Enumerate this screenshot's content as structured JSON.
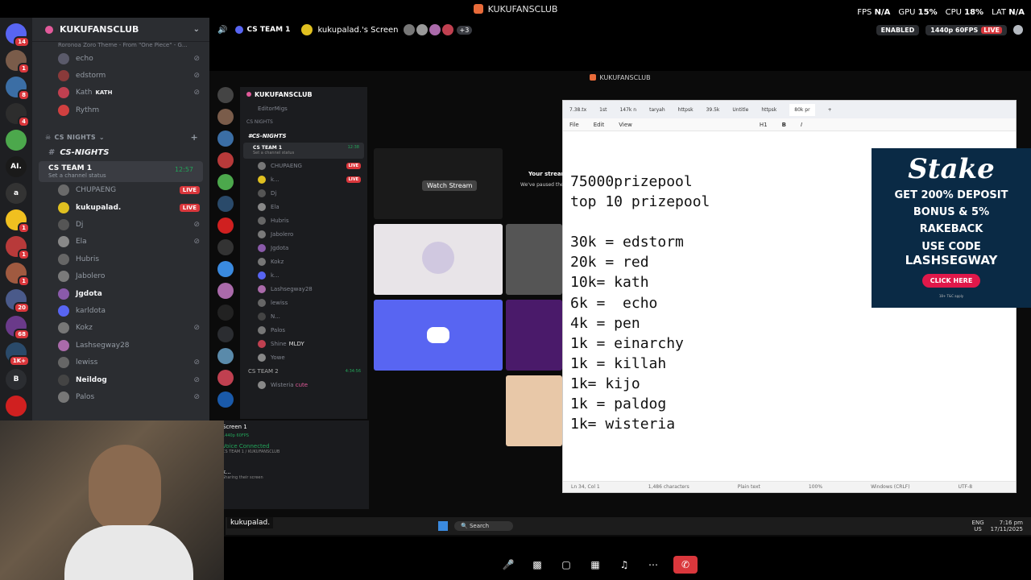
{
  "window": {
    "title": "KUKUFANSCLUB"
  },
  "guild_rail": {
    "items": [
      {
        "name": "discord-home-icon",
        "badge": "14",
        "color": "#5865f2"
      },
      {
        "name": "guild-icon",
        "badge": "1",
        "color": "#7a5c4a"
      },
      {
        "name": "guild-icon",
        "badge": "8",
        "color": "#3b6ea5"
      },
      {
        "name": "guild-icon",
        "badge": "4",
        "color": "#2d2d2d"
      },
      {
        "name": "guild-icon",
        "badge": "",
        "color": "#4ca84c"
      },
      {
        "name": "guild-icon",
        "badge": "",
        "label": "AI.",
        "color": "#1a1a1a"
      },
      {
        "name": "guild-icon",
        "badge": "",
        "label": "a",
        "color": "#333"
      },
      {
        "name": "guild-icon",
        "badge": "1",
        "color": "#f0c020"
      },
      {
        "name": "guild-icon",
        "badge": "1",
        "color": "#b83a3a"
      },
      {
        "name": "guild-icon",
        "badge": "1",
        "color": "#a05a40"
      },
      {
        "name": "guild-icon",
        "badge": "20",
        "color": "#4a5a8a"
      },
      {
        "name": "guild-icon",
        "badge": "68",
        "color": "#6a3a8a"
      },
      {
        "name": "guild-icon",
        "badge": "1K+",
        "color": "#2a4a6a"
      },
      {
        "name": "guild-icon",
        "badge": "",
        "label": "B",
        "color": "#2b2d31"
      },
      {
        "name": "guild-icon",
        "badge": "",
        "color": "#d02020"
      }
    ]
  },
  "channel_list": {
    "server_name": "KUKUFANSCLUB",
    "top_item": "Roronoa Zoro Theme - From \"One Piece\" - G...",
    "members_top": [
      {
        "name": "echo",
        "muted": true,
        "color": "#5a5a6a"
      },
      {
        "name": "edstorm",
        "muted": true,
        "color": "#8a3a3a"
      },
      {
        "name": "Kath",
        "tag": "KATH",
        "muted": true,
        "color": "#c04050"
      },
      {
        "name": "Rythm",
        "muted": false,
        "color": "#d04040"
      }
    ],
    "category": "CS NIGHTS",
    "text_channel": "CS-NIGHTS",
    "voice_channel": {
      "name": "CS TEAM 1",
      "status": "Set a channel status",
      "time": "12:57"
    },
    "members": [
      {
        "name": "CHUPAENG",
        "live": true,
        "muted": false,
        "color": "#6a6a6a"
      },
      {
        "name": "kukupalad.",
        "live": true,
        "muted": false,
        "color": "#e0c020",
        "bold": true
      },
      {
        "name": "Dj",
        "live": false,
        "muted": true,
        "color": "#555"
      },
      {
        "name": "Ela",
        "live": false,
        "muted": true,
        "color": "#888"
      },
      {
        "name": "Hubris",
        "live": false,
        "muted": false,
        "color": "#666"
      },
      {
        "name": "Jabolero",
        "live": false,
        "muted": false,
        "color": "#7a7a7a"
      },
      {
        "name": "Jgdota",
        "live": false,
        "muted": false,
        "color": "#8a5aaa",
        "bold": true
      },
      {
        "name": "karldota",
        "live": false,
        "muted": false,
        "color": "#5865f2"
      },
      {
        "name": "Kokz",
        "live": false,
        "muted": true,
        "color": "#777"
      },
      {
        "name": "Lashsegway28",
        "live": false,
        "muted": false,
        "color": "#aa6aaa"
      },
      {
        "name": "lewiss",
        "live": false,
        "muted": true,
        "color": "#666"
      },
      {
        "name": "Neildog",
        "live": false,
        "muted": true,
        "color": "#444",
        "bold": true
      },
      {
        "name": "Palos",
        "live": false,
        "muted": true,
        "color": "#777"
      }
    ],
    "live_label": "LIVE"
  },
  "topbar": {
    "channel": "CS TEAM 1",
    "screen_owner": "kukupalad.'s Screen",
    "extra_viewers": "+3"
  },
  "stats": {
    "fps_label": "FPS",
    "fps": "N/A",
    "gpu_label": "GPU",
    "gpu": "15%",
    "cpu_label": "CPU",
    "cpu": "18%",
    "lat_label": "LAT",
    "lat": "N/A",
    "enabled": "ENABLED",
    "quality": "1440p 60FPS",
    "live": "LIVE"
  },
  "shared_screen": {
    "title": "KUKUFANSCLUB",
    "inner_server": "KUKUFANSCLUB",
    "inner_first": "EditorMigs",
    "inner_category": "CS NIGHTS",
    "inner_text_channel": "CS-NIGHTS",
    "inner_voice": {
      "name": "CS TEAM 1",
      "status": "Set a channel status",
      "time": "12:38"
    },
    "inner_members": [
      {
        "name": "CHUPAENG",
        "live": true
      },
      {
        "name": "k...",
        "live": true
      },
      {
        "name": "Dj",
        "live": false
      },
      {
        "name": "Ela",
        "live": false
      },
      {
        "name": "Hubris",
        "live": false
      },
      {
        "name": "Jabolero",
        "live": false
      },
      {
        "name": "Jgdota",
        "live": false
      },
      {
        "name": "Kokz",
        "live": false
      },
      {
        "name": "k...",
        "live": false
      },
      {
        "name": "Lashsegway28",
        "live": false
      },
      {
        "name": "lewiss",
        "live": false
      },
      {
        "name": "N...",
        "live": false
      },
      {
        "name": "Palos",
        "live": false
      },
      {
        "name": "Shine",
        "live": false,
        "tag": "MLDY"
      },
      {
        "name": "Yowe",
        "live": false
      }
    ],
    "inner_voice2": {
      "name": "CS TEAM 2",
      "time": "4:34:56"
    },
    "inner_member_last": "Wisteria",
    "inner_member_last_tag": "cute",
    "screen_label": "Screen 1",
    "screen_sub": "1440p 60FPS",
    "voice_connected": "Voice Connected",
    "voice_path": "CS TEAM 1 / KUKUFANSCLUB",
    "user_short": "k...",
    "user_status": "Sharing their screen",
    "watch_stream": "Watch Stream",
    "your_stream": "Your stream",
    "paused_text": "We've paused the"
  },
  "notepad": {
    "tabs": [
      "7.38.tx",
      "1st",
      "147k n",
      "taryah",
      "httpsk",
      "39.5k",
      "Untitle",
      "httpsk",
      "80k pr"
    ],
    "menu": [
      "File",
      "Edit",
      "View"
    ],
    "heading_control": "H1",
    "lines": [
      "75000prizepool",
      "top 10 prizepool",
      "",
      "30k = edstorm",
      "20k = red",
      "10k= kath",
      "6k =  echo",
      "4k = pen",
      "1k = einarchy",
      "1k = killah",
      "1k= kijo",
      "1k = paldog",
      "1k= wisteria"
    ],
    "status": {
      "pos": "Ln 34, Col 1",
      "chars": "1,486 characters",
      "format": "Plain text",
      "zoom": "100%",
      "eol": "Windows (CRLF)",
      "enc": "UTF-8"
    }
  },
  "ad": {
    "brand": "Stake",
    "line1": "GET 200% DEPOSIT",
    "line2": "BONUS & 5%",
    "line3": "RAKEBACK",
    "line4": "USE CODE",
    "code": "LASHSEGWAY",
    "button": "CLICK HERE",
    "fine": "18+ T&C apply"
  },
  "taskbar": {
    "search": "Search",
    "lang": "ENG",
    "region": "US",
    "time": "7:16 pm",
    "date": "17/11/2025"
  },
  "caption": {
    "name": "kukupalad."
  }
}
